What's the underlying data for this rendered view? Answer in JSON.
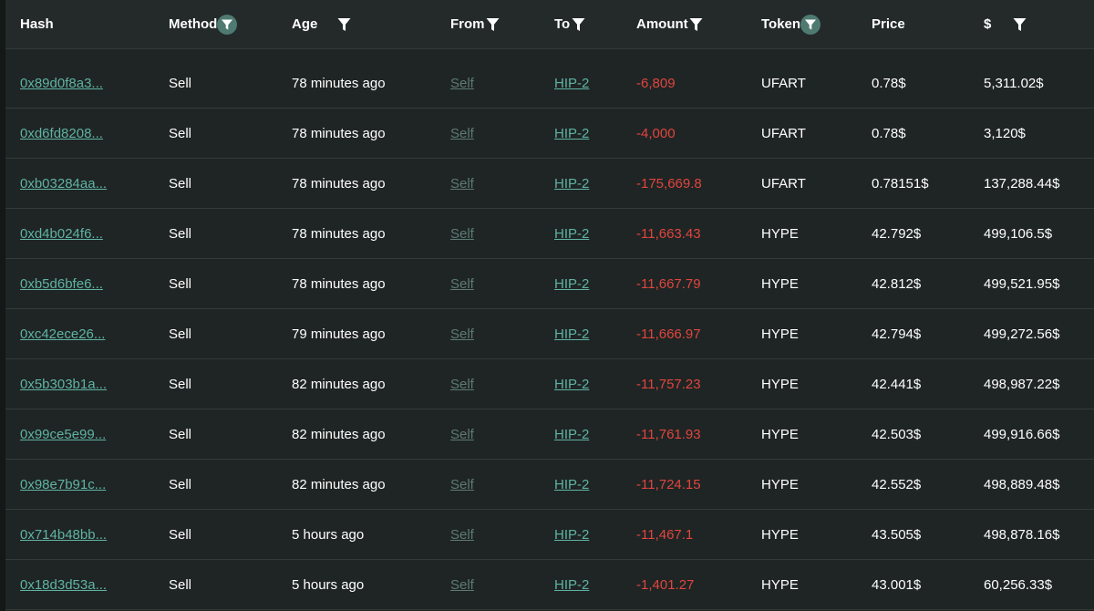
{
  "colors": {
    "background": "#1f2524",
    "header_background": "#232a29",
    "link": "#5fb3a5",
    "muted_link": "#5d7a74",
    "negative": "#e0453f",
    "filter_active_badge": "#4f7a72"
  },
  "columns": [
    {
      "key": "hash",
      "label": "Hash",
      "filter": "none"
    },
    {
      "key": "method",
      "label": "Method",
      "filter": "active"
    },
    {
      "key": "age",
      "label": "Age",
      "filter": "plain"
    },
    {
      "key": "from",
      "label": "From",
      "filter": "plain"
    },
    {
      "key": "to",
      "label": "To",
      "filter": "plain"
    },
    {
      "key": "amount",
      "label": "Amount",
      "filter": "plain"
    },
    {
      "key": "token",
      "label": "Token",
      "filter": "active"
    },
    {
      "key": "price",
      "label": "Price",
      "filter": "none"
    },
    {
      "key": "usd",
      "label": "$",
      "filter": "plain"
    }
  ],
  "rows": [
    {
      "hash": "0x89d0f8a3...",
      "method": "Sell",
      "age": "78 minutes ago",
      "from": "Self",
      "to": "HIP-2",
      "amount": "-6,809",
      "token": "UFART",
      "price": "0.78$",
      "usd": "5,311.02$"
    },
    {
      "hash": "0xd6fd8208...",
      "method": "Sell",
      "age": "78 minutes ago",
      "from": "Self",
      "to": "HIP-2",
      "amount": "-4,000",
      "token": "UFART",
      "price": "0.78$",
      "usd": "3,120$"
    },
    {
      "hash": "0xb03284aa...",
      "method": "Sell",
      "age": "78 minutes ago",
      "from": "Self",
      "to": "HIP-2",
      "amount": "-175,669.8",
      "token": "UFART",
      "price": "0.78151$",
      "usd": "137,288.44$"
    },
    {
      "hash": "0xd4b024f6...",
      "method": "Sell",
      "age": "78 minutes ago",
      "from": "Self",
      "to": "HIP-2",
      "amount": "-11,663.43",
      "token": "HYPE",
      "price": "42.792$",
      "usd": "499,106.5$"
    },
    {
      "hash": "0xb5d6bfe6...",
      "method": "Sell",
      "age": "78 minutes ago",
      "from": "Self",
      "to": "HIP-2",
      "amount": "-11,667.79",
      "token": "HYPE",
      "price": "42.812$",
      "usd": "499,521.95$"
    },
    {
      "hash": "0xc42ece26...",
      "method": "Sell",
      "age": "79 minutes ago",
      "from": "Self",
      "to": "HIP-2",
      "amount": "-11,666.97",
      "token": "HYPE",
      "price": "42.794$",
      "usd": "499,272.56$"
    },
    {
      "hash": "0x5b303b1a...",
      "method": "Sell",
      "age": "82 minutes ago",
      "from": "Self",
      "to": "HIP-2",
      "amount": "-11,757.23",
      "token": "HYPE",
      "price": "42.441$",
      "usd": "498,987.22$"
    },
    {
      "hash": "0x99ce5e99...",
      "method": "Sell",
      "age": "82 minutes ago",
      "from": "Self",
      "to": "HIP-2",
      "amount": "-11,761.93",
      "token": "HYPE",
      "price": "42.503$",
      "usd": "499,916.66$"
    },
    {
      "hash": "0x98e7b91c...",
      "method": "Sell",
      "age": "82 minutes ago",
      "from": "Self",
      "to": "HIP-2",
      "amount": "-11,724.15",
      "token": "HYPE",
      "price": "42.552$",
      "usd": "498,889.48$"
    },
    {
      "hash": "0x714b48bb...",
      "method": "Sell",
      "age": "5 hours ago",
      "from": "Self",
      "to": "HIP-2",
      "amount": "-11,467.1",
      "token": "HYPE",
      "price": "43.505$",
      "usd": "498,878.16$"
    },
    {
      "hash": "0x18d3d53a...",
      "method": "Sell",
      "age": "5 hours ago",
      "from": "Self",
      "to": "HIP-2",
      "amount": "-1,401.27",
      "token": "HYPE",
      "price": "43.001$",
      "usd": "60,256.33$"
    }
  ]
}
